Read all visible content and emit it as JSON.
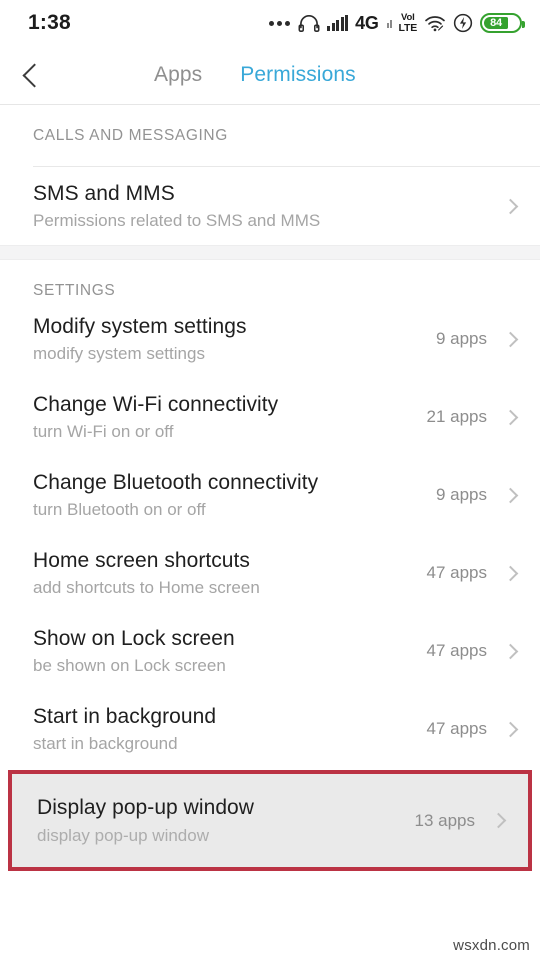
{
  "status_bar": {
    "time": "1:38",
    "icons": [
      {
        "name": "more-dots-icon",
        "label": "•••"
      },
      {
        "name": "headphones-icon",
        "label": "headphones"
      },
      {
        "name": "signal-bars-icon",
        "label": "signal"
      },
      {
        "name": "network-type-label",
        "label": "4G"
      },
      {
        "name": "secondary-signal-icon",
        "label": "signal2"
      },
      {
        "name": "volte-icon",
        "label_top": "VoI",
        "label_bottom": "LTE"
      },
      {
        "name": "wifi-icon",
        "label": "wifi"
      },
      {
        "name": "flash-icon",
        "label": "flash"
      },
      {
        "name": "battery-icon",
        "label": "84"
      }
    ],
    "network_type": "4G",
    "volte_top": "VoI",
    "volte_bottom": "LTE",
    "battery_level": "84"
  },
  "header": {
    "back_label": "back",
    "tabs": [
      {
        "label": "Apps",
        "active": false
      },
      {
        "label": "Permissions",
        "active": true
      }
    ],
    "active_color": "#39a8d8"
  },
  "sections": [
    {
      "title": "CALLS AND MESSAGING",
      "has_divider": true,
      "rows": [
        {
          "title": "SMS and MMS",
          "subtitle": "Permissions related to SMS and MMS",
          "count": "",
          "highlighted": false
        }
      ]
    },
    {
      "title": "SETTINGS",
      "has_divider": false,
      "rows": [
        {
          "title": "Modify system settings",
          "subtitle": "modify system settings",
          "count": "9 apps",
          "highlighted": false
        },
        {
          "title": "Change Wi-Fi connectivity",
          "subtitle": "turn Wi-Fi on or off",
          "count": "21 apps",
          "highlighted": false
        },
        {
          "title": "Change Bluetooth connectivity",
          "subtitle": "turn Bluetooth on or off",
          "count": "9 apps",
          "highlighted": false
        },
        {
          "title": "Home screen shortcuts",
          "subtitle": "add shortcuts to Home screen",
          "count": "47 apps",
          "highlighted": false
        },
        {
          "title": "Show on Lock screen",
          "subtitle": "be shown on Lock screen",
          "count": "47 apps",
          "highlighted": false
        },
        {
          "title": "Start in background",
          "subtitle": "start in background",
          "count": "47 apps",
          "highlighted": false
        },
        {
          "title": "Display pop-up window",
          "subtitle": "display pop-up window",
          "count": "13 apps",
          "highlighted": true
        }
      ]
    }
  ],
  "highlight": {
    "border_color": "#bb3344",
    "background_color": "#eaeaea"
  },
  "watermark": {
    "text": "wsxdn.com"
  }
}
